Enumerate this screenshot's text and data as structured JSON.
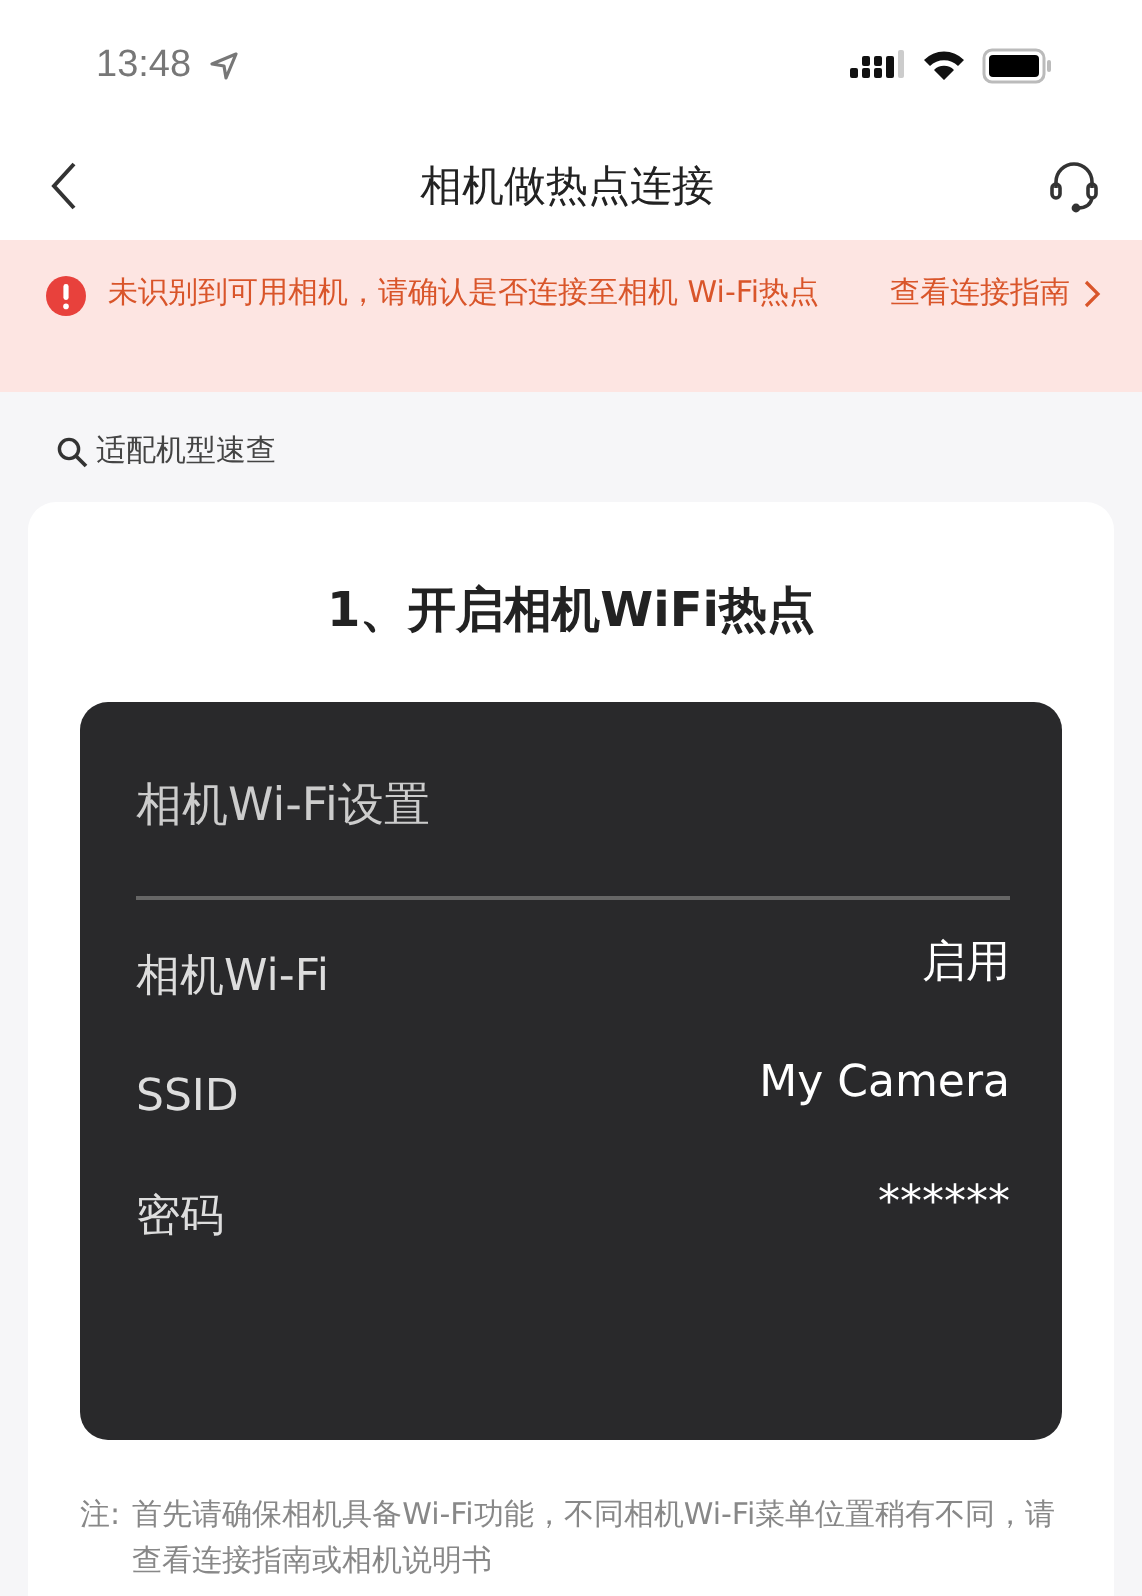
{
  "status_bar": {
    "time": "13:48"
  },
  "nav": {
    "title": "相机做热点连接"
  },
  "alert": {
    "message": "未识别到可用相机，请确认是否连接至相机 Wi-Fi热点",
    "link": "查看连接指南"
  },
  "search_link": {
    "label": "适配机型速查"
  },
  "step": {
    "title": "1、开启相机WiFi热点",
    "panel": {
      "title": "相机Wi-Fi设置",
      "rows": [
        {
          "label": "相机Wi-Fi",
          "value": "启用"
        },
        {
          "label": "SSID",
          "value": "My Camera"
        },
        {
          "label": "密码",
          "value": "******"
        }
      ]
    },
    "note": {
      "label": "注:",
      "text": "首先请确保相机具备Wi-Fi功能，不同相机Wi-Fi菜单位置稍有不同，请查看连接指南或相机说明书"
    }
  }
}
